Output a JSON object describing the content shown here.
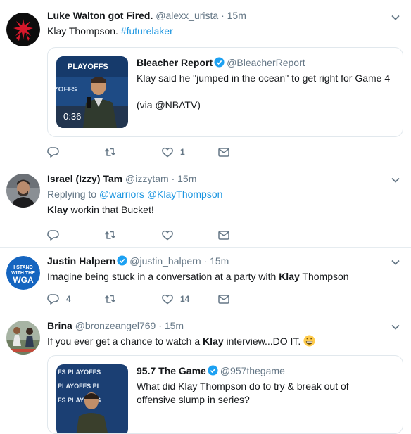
{
  "tweets": [
    {
      "name": "Luke Walton got Fired.",
      "handle": "@alexx_urista",
      "time": "15m",
      "text_plain": "Klay Thompson. ",
      "hashtag": "#futurelaker",
      "quote": {
        "name": "Bleacher Report",
        "handle": "@BleacherReport",
        "line1": "Klay said he \"jumped in the ocean\" to get right for Game 4",
        "line2": "(via @NBATV)",
        "duration": "0:36",
        "thumb_text": "PLAYOFFS"
      },
      "like_count": "1"
    },
    {
      "name": "Israel (Izzy) Tam",
      "handle": "@izzytam",
      "time": "15m",
      "reply_prefix": "Replying to",
      "reply_user1": "@warriors",
      "reply_user2": "@KlayThompson",
      "text_bold": "Klay",
      "text_rest": " workin that Bucket!"
    },
    {
      "name": "Justin Halpern",
      "handle": "@justin_halpern",
      "time": "15m",
      "text_pre": "Imagine being stuck in a conversation at a party with ",
      "text_bold": "Klay",
      "text_post": " Thompson",
      "avatar_lines": [
        "I STAND",
        "WITH THE",
        "WGA"
      ],
      "reply_count": "4",
      "like_count": "14"
    },
    {
      "name": "Brina",
      "handle": "@bronzeangel769",
      "time": "15m",
      "text_pre": "If you ever get a chance to watch a ",
      "text_bold": "Klay",
      "text_post": " interview...DO IT.",
      "quote": {
        "name": "95.7 The Game",
        "handle": "@957thegame",
        "line1": "What did Klay Thompson do to try & break out of",
        "line2": "offensive slump in series?"
      }
    }
  ],
  "dot": "·",
  "colors": {
    "link": "#1b95e0",
    "verified": "#1da1f2",
    "meta": "#657786"
  }
}
